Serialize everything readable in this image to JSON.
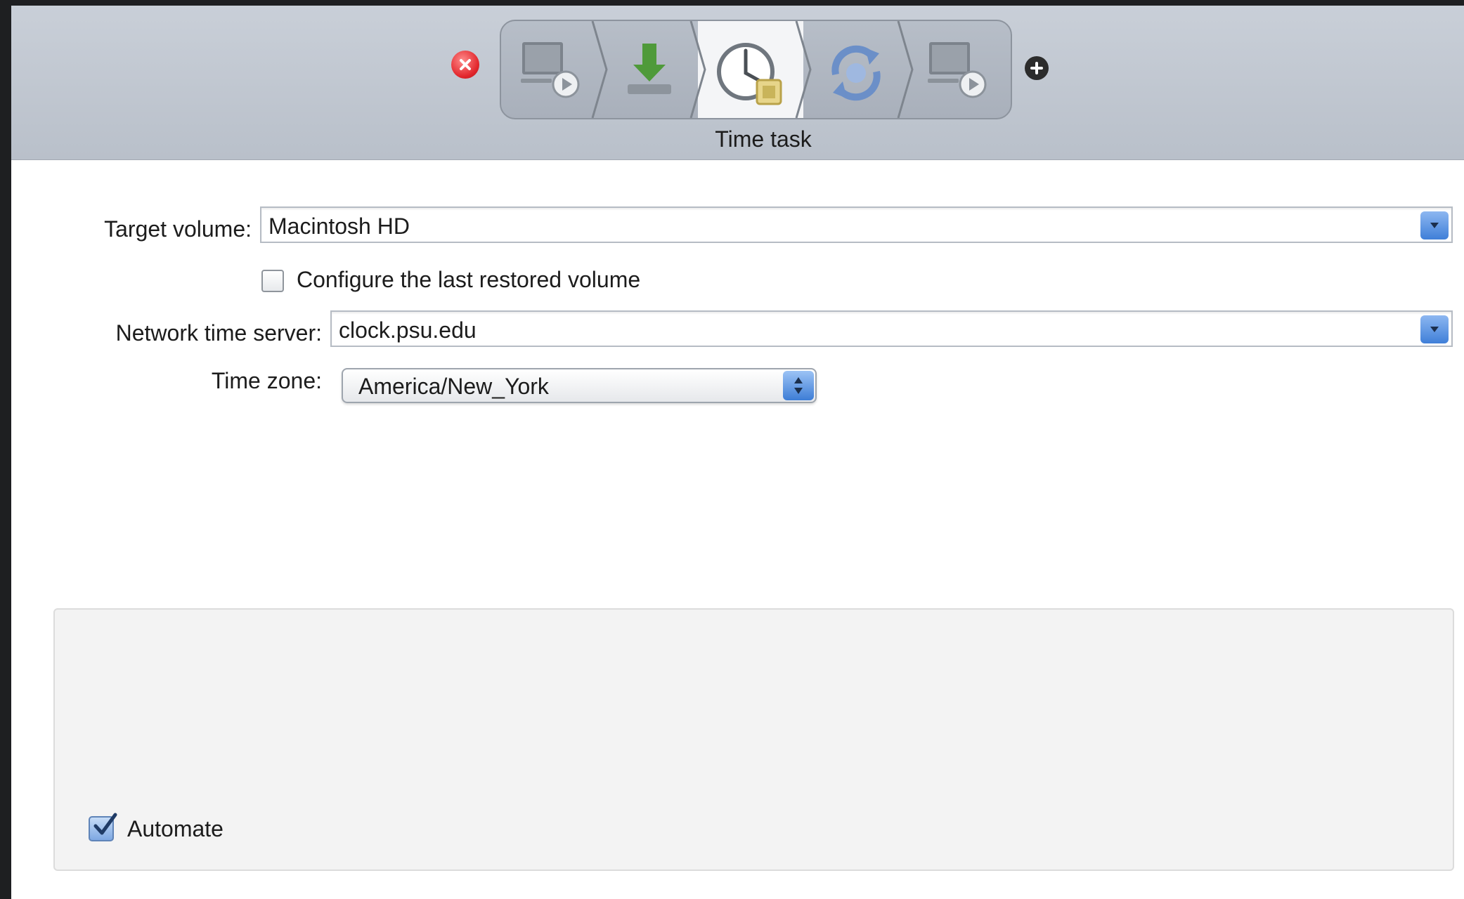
{
  "toolbar": {
    "workflow_steps": [
      {
        "icon": "display-play-icon",
        "selected": false
      },
      {
        "icon": "download-arrow-icon",
        "selected": false
      },
      {
        "icon": "clock-icon",
        "selected": true
      },
      {
        "icon": "sync-arrows-icon",
        "selected": false
      },
      {
        "icon": "display-play-icon",
        "selected": false
      }
    ],
    "selected_step_label": "Time task",
    "remove_icon": "remove-icon",
    "add_icon": "add-icon"
  },
  "form": {
    "target_volume_label": "Target volume:",
    "target_volume_value": "Macintosh HD",
    "configure_last_label": "Configure the last restored volume",
    "configure_last_checked": false,
    "network_time_server_label": "Network time server:",
    "network_time_server_value": "clock.psu.edu",
    "time_zone_label": "Time zone:",
    "time_zone_value": "America/New_York"
  },
  "footer": {
    "automate_label": "Automate",
    "automate_checked": true
  },
  "colors": {
    "toolbar_bg": "#c3c9d2",
    "accent_blue": "#3f7fd8",
    "remove_red": "#e2262c"
  }
}
